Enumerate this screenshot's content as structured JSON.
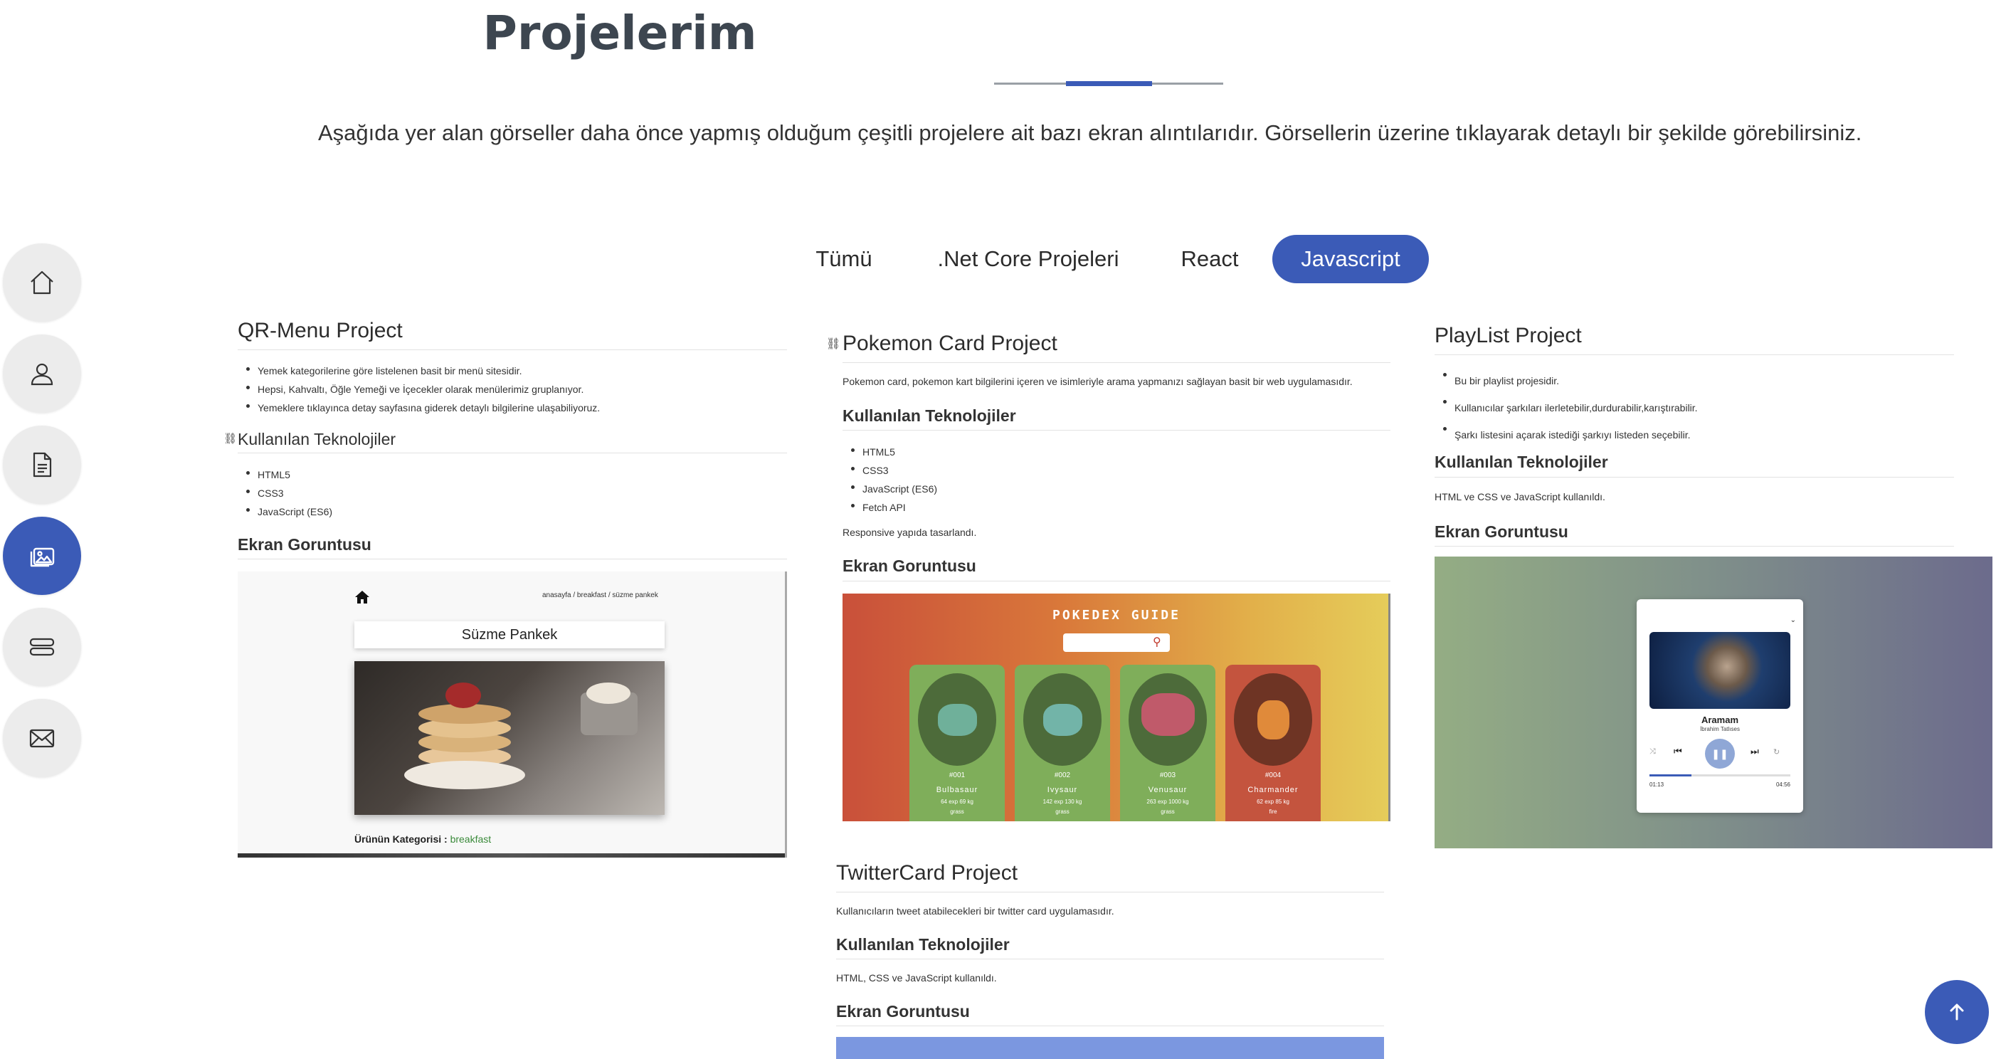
{
  "header": {
    "title": "Projelerim",
    "intro": "Aşağıda yer alan görseller daha önce yapmış olduğum çeşitli projelere ait bazı ekran alıntılarıdır. Görsellerin üzerine tıklayarak detaylı bir şekilde görebilirsiniz."
  },
  "nav": {
    "items": [
      {
        "icon": "home-icon"
      },
      {
        "icon": "user-icon"
      },
      {
        "icon": "document-icon"
      },
      {
        "icon": "images-icon",
        "active": true
      },
      {
        "icon": "server-icon"
      },
      {
        "icon": "envelope-icon"
      }
    ]
  },
  "filters": {
    "all": "Tümü",
    "net_core": ".Net Core Projeleri",
    "react": "React",
    "javascript": "Javascript",
    "active": "Javascript"
  },
  "qr_menu": {
    "title": "QR-Menu Project",
    "bullets": [
      "Yemek kategorilerine göre listelenen basit bir menü sitesidir.",
      "Hepsi, Kahvaltı, Öğle Yemeği ve İçecekler olarak menülerimiz gruplanıyor.",
      "Yemeklere tıklayınca detay sayfasına giderek detaylı bilgilerine ulaşabiliyoruz."
    ],
    "tech_heading": "Kullanılan Teknolojiler",
    "tech": [
      "HTML5",
      "CSS3",
      "JavaScript (ES6)"
    ],
    "screenshot_heading": "Ekran Goruntusu",
    "shot": {
      "breadcrumb": "anasayfa / breakfast / süzme pankek",
      "product": "Süzme Pankek",
      "category_label": "Ürünün Kategorisi :",
      "category_value": "breakfast"
    }
  },
  "pokemon": {
    "title": "Pokemon Card Project",
    "description": "Pokemon card, pokemon kart bilgilerini içeren ve isimleriyle arama yapmanızı sağlayan basit bir web uygulamasıdır.",
    "tech_heading": "Kullanılan Teknolojiler",
    "tech": [
      "HTML5",
      "CSS3",
      "JavaScript (ES6)",
      "Fetch API"
    ],
    "note": "Responsive yapıda tasarlandı.",
    "screenshot_heading": "Ekran Goruntusu",
    "shot": {
      "header": "POKEDEX GUIDE",
      "cards": [
        {
          "num": "#001",
          "name": "Bulbasaur",
          "stats": "64 exp  69 kg",
          "type": "grass"
        },
        {
          "num": "#002",
          "name": "Ivysaur",
          "stats": "142 exp  130 kg",
          "type": "grass"
        },
        {
          "num": "#003",
          "name": "Venusaur",
          "stats": "263 exp  1000 kg",
          "type": "grass"
        },
        {
          "num": "#004",
          "name": "Charmander",
          "stats": "62 exp  85 kg",
          "type": "fire"
        }
      ]
    }
  },
  "playlist": {
    "title": "PlayList Project",
    "bullets": [
      "Bu bir playlist projesidir.",
      "Kullanıcılar şarkıları ilerletebilir,durdurabilir,karıştırabilir.",
      "Şarkı listesini açarak istediği şarkıyı listeden seçebilir."
    ],
    "tech_heading": "Kullanılan Teknolojiler",
    "tech_text": "HTML ve CSS ve JavaScript kullanıldı.",
    "screenshot_heading": "Ekran Goruntusu",
    "shot": {
      "song": "Aramam",
      "artist": "İbrahim Tatlıses",
      "time_current": "01:13",
      "time_total": "04:56",
      "progress": 0.3
    }
  },
  "twitter": {
    "title": "TwitterCard Project",
    "description": "Kullanıcıların tweet atabilecekleri bir twitter card uygulamasıdır.",
    "tech_heading": "Kullanılan Teknolojiler",
    "tech_text": "HTML, CSS ve JavaScript kullanıldı.",
    "screenshot_heading": "Ekran Goruntusu"
  },
  "colors": {
    "accent": "#3b5bb7",
    "nav_bg": "#ececec",
    "heading": "#3d4650"
  }
}
